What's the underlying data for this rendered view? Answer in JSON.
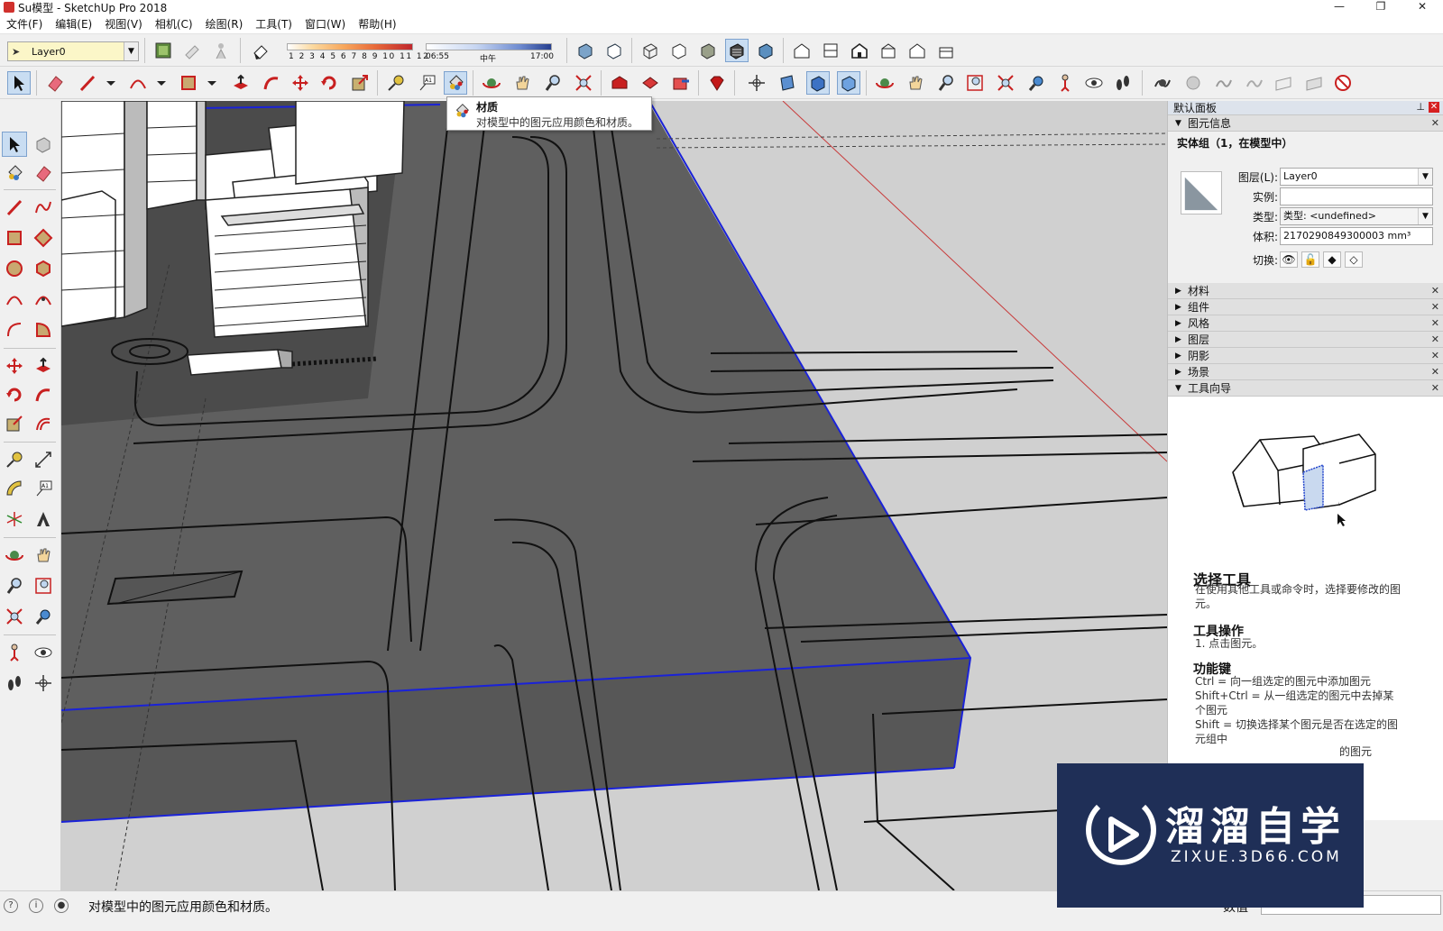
{
  "window": {
    "title": "Su模型 - SketchUp Pro 2018",
    "controls": [
      "—",
      "❐",
      "✕"
    ]
  },
  "menu": [
    "文件(F)",
    "编辑(E)",
    "视图(V)",
    "相机(C)",
    "绘图(R)",
    "工具(T)",
    "窗口(W)",
    "帮助(H)"
  ],
  "layer_toolbar": {
    "current_layer": "Layer0"
  },
  "shadow": {
    "months": "1 2 3 4 5 6 7 8 9 10 11 12",
    "time_start": "06:55",
    "time_mid": "中午",
    "time_end": "17:00"
  },
  "tooltip": {
    "title": "材质",
    "description": "对模型中的图元应用颜色和材质。"
  },
  "tray": {
    "title": "默认面板",
    "entity_info": {
      "header": "图元信息",
      "object": "实体组（1，在模型中）",
      "layer_label": "图层(L):",
      "layer_value": "Layer0",
      "instance_label": "实例:",
      "instance_value": "",
      "type_label": "类型:",
      "type_value": "类型: <undefined>",
      "volume_label": "体积:",
      "volume_value": "2170290849300003 mm³",
      "toggles_label": "切换:"
    },
    "panels": [
      "材料",
      "组件",
      "风格",
      "图层",
      "阴影",
      "场景"
    ],
    "instructor": {
      "header": "工具向导",
      "tool_name": "选择工具",
      "tool_desc": "在使用其他工具或命令时，选择要修改的图元。",
      "ops_title": "工具操作",
      "ops_text": "1. 点击图元。",
      "keys_title": "功能键",
      "keys_1": "Ctrl = 向一组选定的图元中添加图元",
      "keys_2": "Shift+Ctrl = 从一组选定的图元中去掉某个图元",
      "keys_3": "Shift = 切换选择某个图元是否在选定的图元组中",
      "keys_4": "的图元",
      "more": "..."
    }
  },
  "status": {
    "message": "对模型中的图元应用颜色和材质。",
    "measurements_label": "数值",
    "measurements_value": ""
  },
  "watermark": {
    "title": "溜溜自学",
    "subtitle": "ZIXUE.3D66.COM"
  },
  "colors": {
    "selection_blue": "#1a22d8",
    "ground_dark": "#5f5f5f",
    "ground_light": "#d0d0d0",
    "tooltip_bg": "#ffffff",
    "watermark_bg": "#1f2f57"
  }
}
